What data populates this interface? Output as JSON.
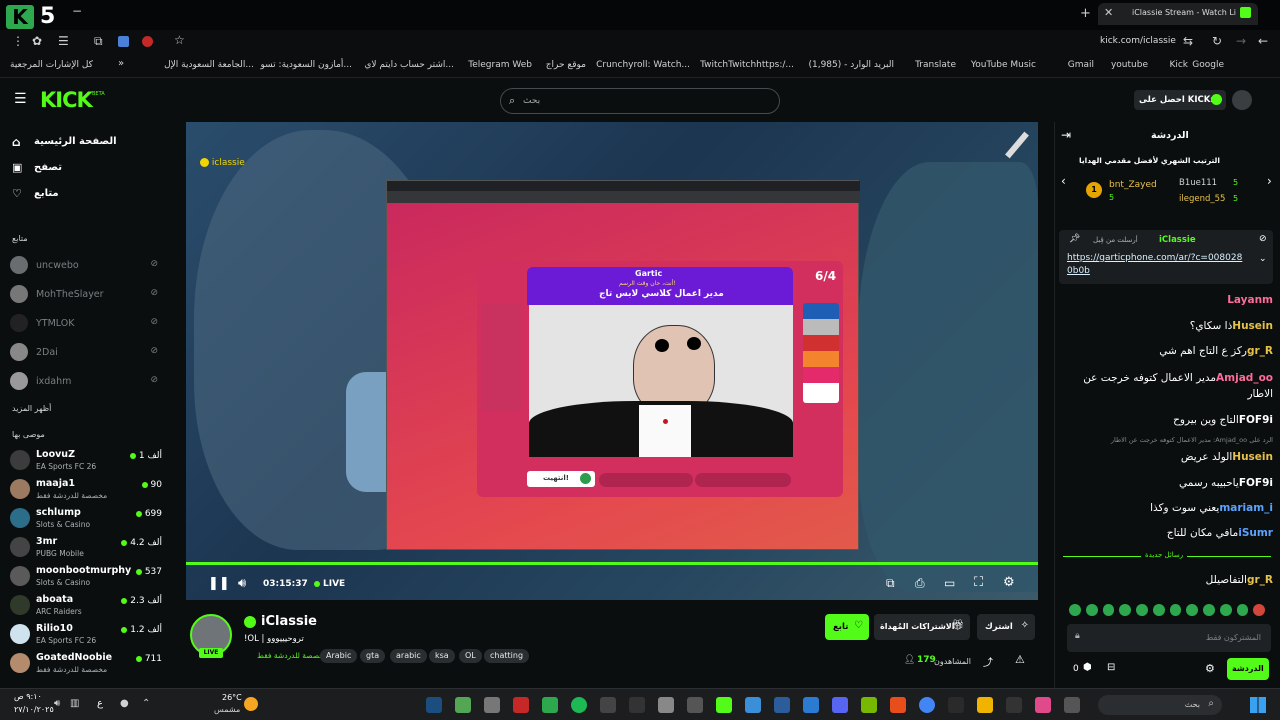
{
  "browser": {
    "tab_title": "iClassie Stream - Watch Live",
    "url": "kick.com/iclassie",
    "badge_number": "5",
    "bookmarks": [
      "Google",
      "Kick",
      "youtube",
      "Gmail",
      "YouTube Music",
      "Translate",
      "البريد الوارد - (1,985)",
      "TwitchTwitchhttps:/...",
      "Crunchyroll: Watch...",
      "موقع حراج",
      "Telegram Web",
      "اشتر حساب دايتم لاي...",
      "أمازون السعودية: تسو...",
      "الجامعة السعودية الإل...",
      "كل الإشارات المرجعية"
    ]
  },
  "header": {
    "logo": "KICK",
    "beta": "BETA",
    "search_placeholder": "بحث",
    "get_kicks": "احصل على KICKs"
  },
  "sidebar": {
    "nav": [
      "الصفحة الرئيسية",
      "تصفح",
      "متابع"
    ],
    "following_title": "متابع",
    "following": [
      "uncwebo",
      "MohTheSlayer",
      "YTMLOK",
      "2Dai",
      "ixdahm"
    ],
    "show_more": "أظهر المزيد",
    "recommended_title": "موصى بها",
    "recommended": [
      {
        "name": "LoovuZ",
        "category": "EA Sports FC 26",
        "viewers": "1 ألف"
      },
      {
        "name": "maaja1",
        "category": "مخصصة للدردشة فقط",
        "viewers": "90"
      },
      {
        "name": "schlump",
        "category": "Slots & Casino",
        "viewers": "699"
      },
      {
        "name": "3mr",
        "category": "PUBG Mobile",
        "viewers": "4.2 ألف"
      },
      {
        "name": "moonbootmurphy",
        "category": "Slots & Casino",
        "viewers": "537"
      },
      {
        "name": "aboata",
        "category": "ARC Raiders",
        "viewers": "2.3 ألف"
      },
      {
        "name": "Rilio10",
        "category": "EA Sports FC 26",
        "viewers": "1.2 ألف"
      },
      {
        "name": "GoatedNoobie",
        "category": "مخصصة للدردشة فقط",
        "viewers": "711"
      }
    ]
  },
  "video": {
    "overlay_name": "iclassie",
    "game": {
      "progress": "6/4",
      "site_logo": "Gartic",
      "prompt_small": "أنت، حان وقت الرسم!",
      "prompt": "مدير اعمال كلاسي لابس تاج",
      "done": "انتهيت!"
    },
    "time": "03:15:37",
    "live": "LIVE",
    "progress_fraction": 1.0
  },
  "stream": {
    "name": "iClassie",
    "title": "!OL | تروحيييووو",
    "category": "مخصصة للدردشة فقط",
    "live_badge": "LIVE",
    "tags": [
      "Arabic",
      "gta",
      "arabic",
      "ksa",
      "OL",
      "chatting"
    ],
    "follow": "تابع",
    "gift_subs": "الاشتراكات المُهداة",
    "subscribe": "اشترك",
    "viewers_label": "المشاهدون",
    "viewers": "179"
  },
  "chat": {
    "title": "الدردشة",
    "leaderboard_title": "الترتيب الشهري لأفضل مقدمي الهدايا",
    "leaders": [
      {
        "name": "bnt_Zayed",
        "count": "5",
        "rank": "1"
      },
      {
        "name": "B1ue111",
        "count": "5"
      },
      {
        "name": "ilegend_55",
        "count": "5"
      }
    ],
    "pinned_by": "أرسلت من قِبل",
    "pinned_user": "iClassie",
    "pinned_link": "https://garticphone.com/ar/?c=0080280b0b",
    "messages": [
      {
        "user": "Layanm",
        "text": ""
      },
      {
        "user": "Husein",
        "text": "ذا سكاي؟"
      },
      {
        "user": "gr_R",
        "text": "ركز ع التاج اهم شي"
      },
      {
        "user": "Amjad_oo",
        "text": "مدير الاعمال كتوفه خرجت عن الاطار"
      },
      {
        "user": "FOF9i",
        "text": "التاج وين بيروح"
      },
      {
        "user": "",
        "text": "الرد على Amjad_oo: مدير الاعمال كتوفه خرجت عن الاطار"
      },
      {
        "user": "Husein",
        "text": "الولد عريض"
      },
      {
        "user": "FOF9i",
        "text": "ياحبيبه رسمي"
      },
      {
        "user": "mariam_i",
        "text": "يعني سوت وكذا"
      },
      {
        "user": "iSumr",
        "text": "مافي مكان للتاج"
      }
    ],
    "new_messages": "رسائل جديدة",
    "last_message": {
      "user": "gr_R",
      "text": "التفاصيلل"
    },
    "input_placeholder": "المشتركون فقط",
    "send": "الدردشة",
    "count": "0"
  },
  "taskbar": {
    "search": "بحث",
    "weather_temp": "26°C",
    "weather_desc": "مشمس",
    "time": "٩:١٠ ص",
    "date": "٢٧/١٠/٢٠٢٥",
    "lang": "ع"
  },
  "colors": {
    "kick_green": "#53fc18",
    "background": "#0b0e0f",
    "badge_gold": "#e6a400"
  }
}
